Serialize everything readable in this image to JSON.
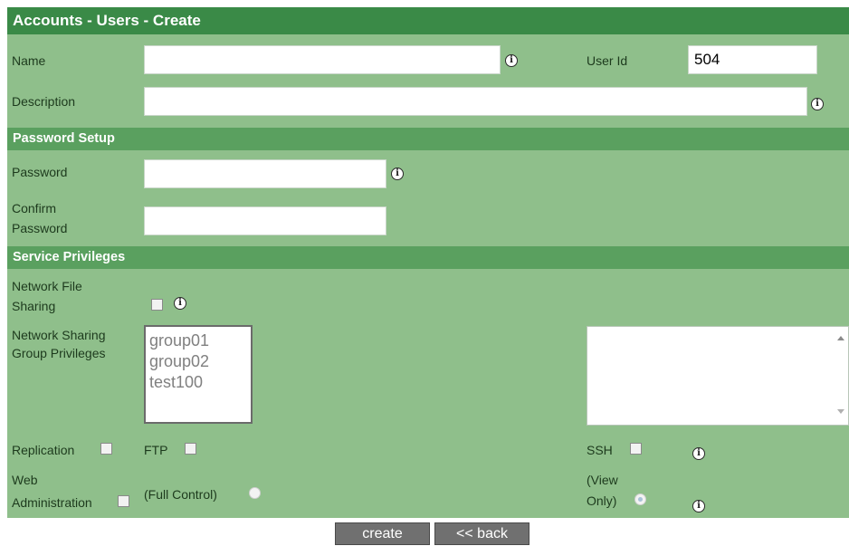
{
  "title": "Accounts - Users - Create",
  "fields": {
    "name_label": "Name",
    "userid_label": "User Id",
    "userid_value": "504",
    "description_label": "Description"
  },
  "password_section": {
    "title": "Password Setup",
    "password_label": "Password",
    "confirm_label_line1": "Confirm",
    "confirm_label_line2": "Password"
  },
  "service_section": {
    "title": "Service Privileges",
    "nfs_line1": "Network File",
    "nfs_line2": "Sharing",
    "group_line1": "Network Sharing",
    "group_line2": "Group Privileges",
    "groups": [
      "group01",
      "group02",
      "test100"
    ],
    "replication_label": "Replication",
    "ftp_label": "FTP",
    "ssh_label": "SSH",
    "webadmin_line1": "Web",
    "webadmin_line2": "Administration",
    "full_control_label": "(Full Control)",
    "view_only_line1": "(View",
    "view_only_line2": "Only)"
  },
  "buttons": {
    "create": "create",
    "back": "<< back"
  },
  "info_icon_glyph": "i",
  "colors": {
    "panel": "#8fbf8b",
    "title_bar": "#3a8a47",
    "section_bar": "#5aa05f",
    "button": "#707070"
  }
}
